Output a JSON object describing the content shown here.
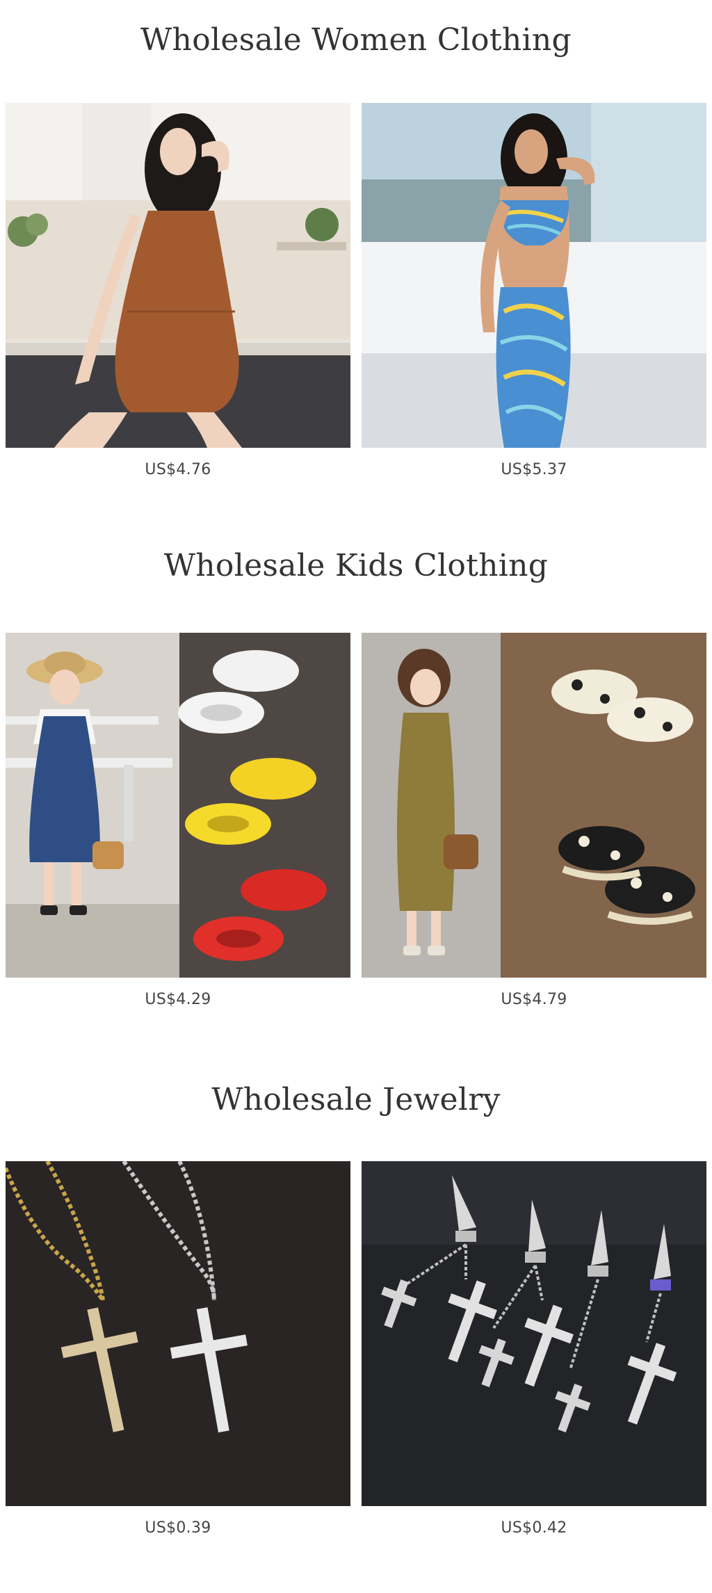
{
  "sections": [
    {
      "title": "Wholesale Women Clothing",
      "products": [
        {
          "price": "US$4.76",
          "image": "ribbed-brown-romper-photo"
        },
        {
          "price": "US$5.37",
          "image": "blue-swirl-halter-skirt-set-photo"
        }
      ]
    },
    {
      "title": "Wholesale Kids Clothing",
      "products": [
        {
          "price": "US$4.29",
          "image": "girl-denim-dress-canvas-shoes-photo"
        },
        {
          "price": "US$4.79",
          "image": "girl-khaki-jumpsuit-polka-shoes-photo"
        }
      ]
    },
    {
      "title": "Wholesale Jewelry",
      "products": [
        {
          "price": "US$0.39",
          "image": "cross-pendant-necklaces-photo"
        },
        {
          "price": "US$0.42",
          "image": "cross-dangle-earrings-photo"
        }
      ]
    }
  ],
  "colors": {
    "title": "#333333",
    "price": "#444444",
    "background": "#ffffff"
  }
}
